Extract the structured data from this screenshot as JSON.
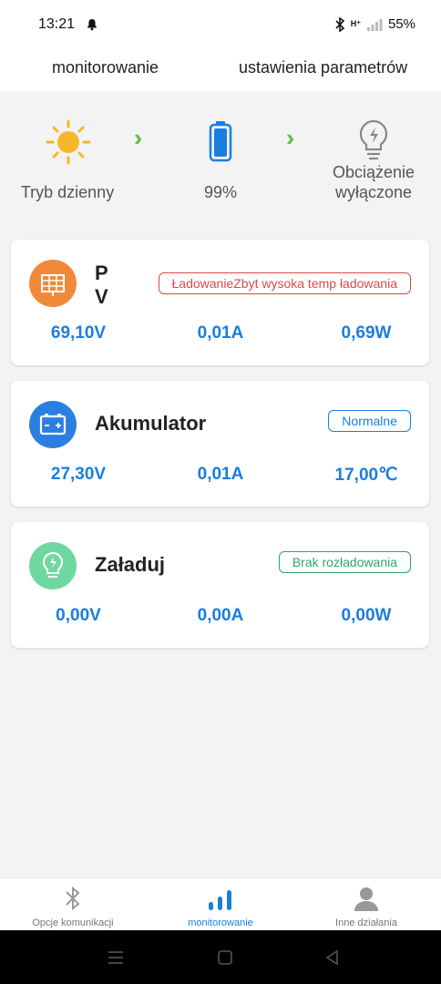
{
  "status": {
    "time": "13:21",
    "battery": "55%",
    "network": "H⁺"
  },
  "topnav": {
    "tabs": [
      {
        "label": "monitorowanie"
      },
      {
        "label": "ustawienia parametrów"
      }
    ]
  },
  "overview": {
    "mode_label": "Tryb dzienny",
    "battery_level": "99%",
    "load_label_line1": "Obciążenie",
    "load_label_line2": "wyłączone"
  },
  "cards": {
    "pv": {
      "title_line1": "P",
      "title_line2": "V",
      "badge": "ŁadowanieZbyt wysoka temp ładowania",
      "badge_color": "#e04848",
      "voltage": "69,10V",
      "current": "0,01A",
      "power": "0,69W"
    },
    "battery": {
      "title": "Akumulator",
      "badge": "Normalne",
      "badge_color": "#1a7ee0",
      "voltage": "27,30V",
      "current": "0,01A",
      "temperature": "17,00℃"
    },
    "load": {
      "title": "Załaduj",
      "badge": "Brak rozładowania",
      "badge_color": "#2ea860",
      "voltage": "0,00V",
      "current": "0,00A",
      "power": "0,00W"
    }
  },
  "bottomnav": {
    "items": [
      {
        "label": "Opcje komunikacji",
        "icon": "bluetooth-icon"
      },
      {
        "label": "monitorowanie",
        "icon": "bars-icon",
        "active": true
      },
      {
        "label": "Inne działania",
        "icon": "user-icon"
      }
    ]
  },
  "colors": {
    "accent": "#1a7ee0",
    "sun": "#f5b62a",
    "chevron": "#68c048"
  }
}
